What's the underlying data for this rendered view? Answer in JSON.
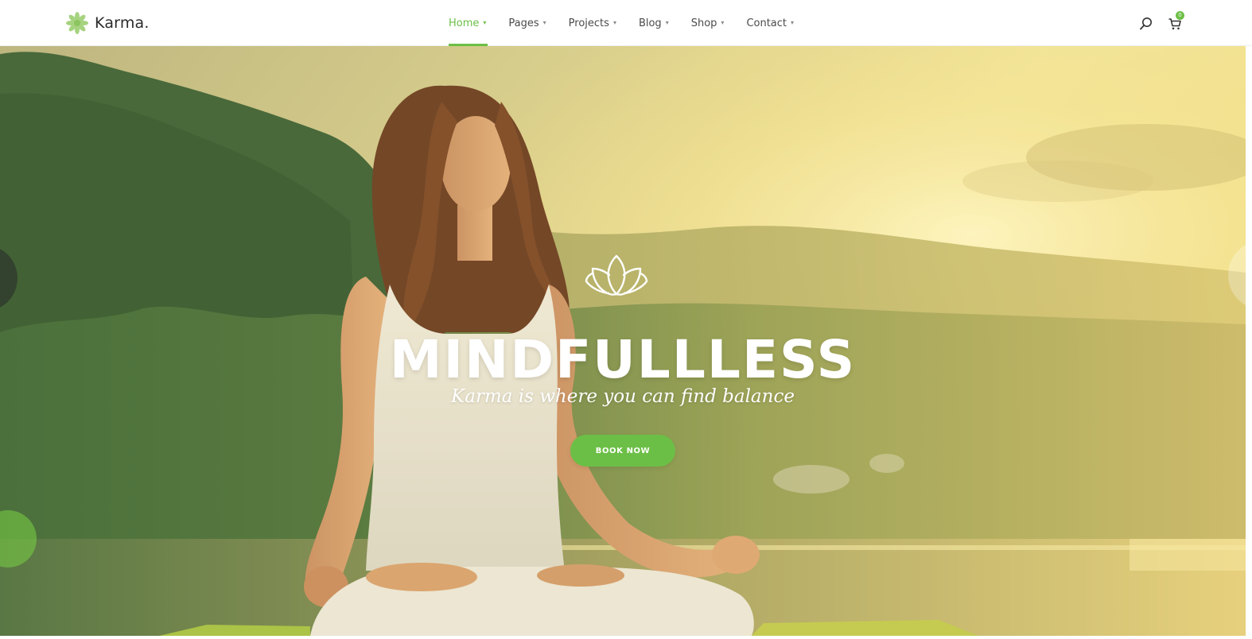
{
  "header": {
    "logo_text": "Karma.",
    "nav": [
      {
        "label": "Home",
        "active": true
      },
      {
        "label": "Pages",
        "active": false
      },
      {
        "label": "Projects",
        "active": false
      },
      {
        "label": "Blog",
        "active": false
      },
      {
        "label": "Shop",
        "active": false
      },
      {
        "label": "Contact",
        "active": false
      }
    ],
    "cart_count": "0",
    "icons": [
      "leaf-logo-icon",
      "search-icon",
      "cart-icon",
      "chevron-down-icon"
    ]
  },
  "hero": {
    "title": "MINDFULLLESS",
    "subtitle": "Karma is where you can find balance",
    "button_label": "BOOK NOW",
    "icons": [
      "lotus-icon",
      "slider-prev-arrow",
      "slider-next-arrow"
    ]
  },
  "colors": {
    "accent": "#6cbf46",
    "nav_text": "#4a4a4a",
    "logo_text": "#2b2b2b",
    "hero_text": "#ffffff"
  }
}
